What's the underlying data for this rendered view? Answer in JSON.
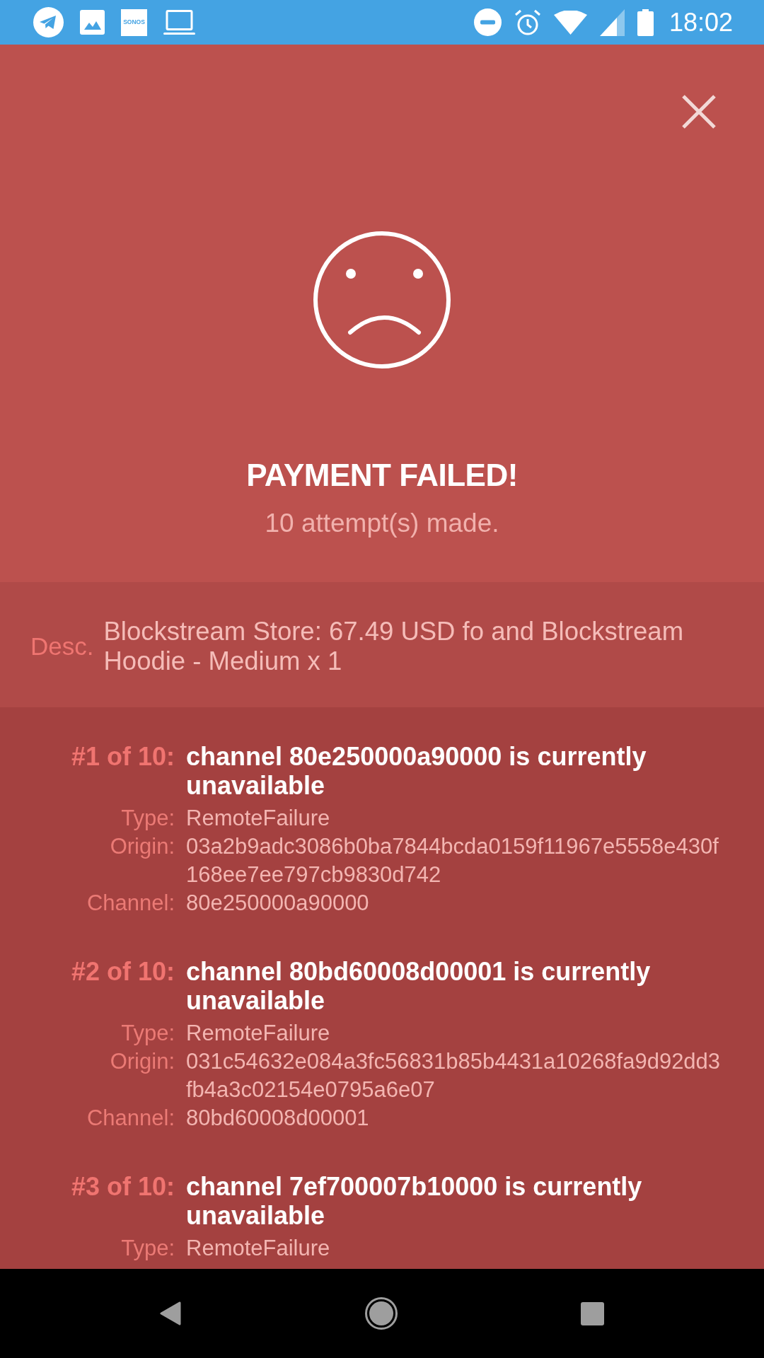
{
  "status_bar": {
    "logo_text": "SONOS",
    "time": "18:02"
  },
  "header": {
    "title": "PAYMENT FAILED!",
    "subtitle": "10 attempt(s) made."
  },
  "description": {
    "label": "Desc.",
    "value": "Blockstream Store: 67.49 USD fo and Blockstream Hoodie - Medium x 1"
  },
  "failures": [
    {
      "heading": "#1 of 10:",
      "message": "channel 80e250000a90000 is currently unavailable",
      "details": [
        {
          "label": "Type:",
          "value": "RemoteFailure"
        },
        {
          "label": "Origin:",
          "value": "03a2b9adc3086b0ba7844bcda0159f11967e5558e430f168ee7ee797cb9830d742"
        },
        {
          "label": "Channel:",
          "value": "80e250000a90000"
        }
      ]
    },
    {
      "heading": "#2 of 10:",
      "message": "channel 80bd60008d00001 is currently unavailable",
      "details": [
        {
          "label": "Type:",
          "value": "RemoteFailure"
        },
        {
          "label": "Origin:",
          "value": "031c54632e084a3fc56831b85b4431a10268fa9d92dd3fb4a3c02154e0795a6e07"
        },
        {
          "label": "Channel:",
          "value": "80bd60008d00001"
        }
      ]
    },
    {
      "heading": "#3 of 10:",
      "message": "channel 7ef700007b10000 is currently unavailable",
      "details": [
        {
          "label": "Type:",
          "value": "RemoteFailure"
        }
      ]
    }
  ]
}
